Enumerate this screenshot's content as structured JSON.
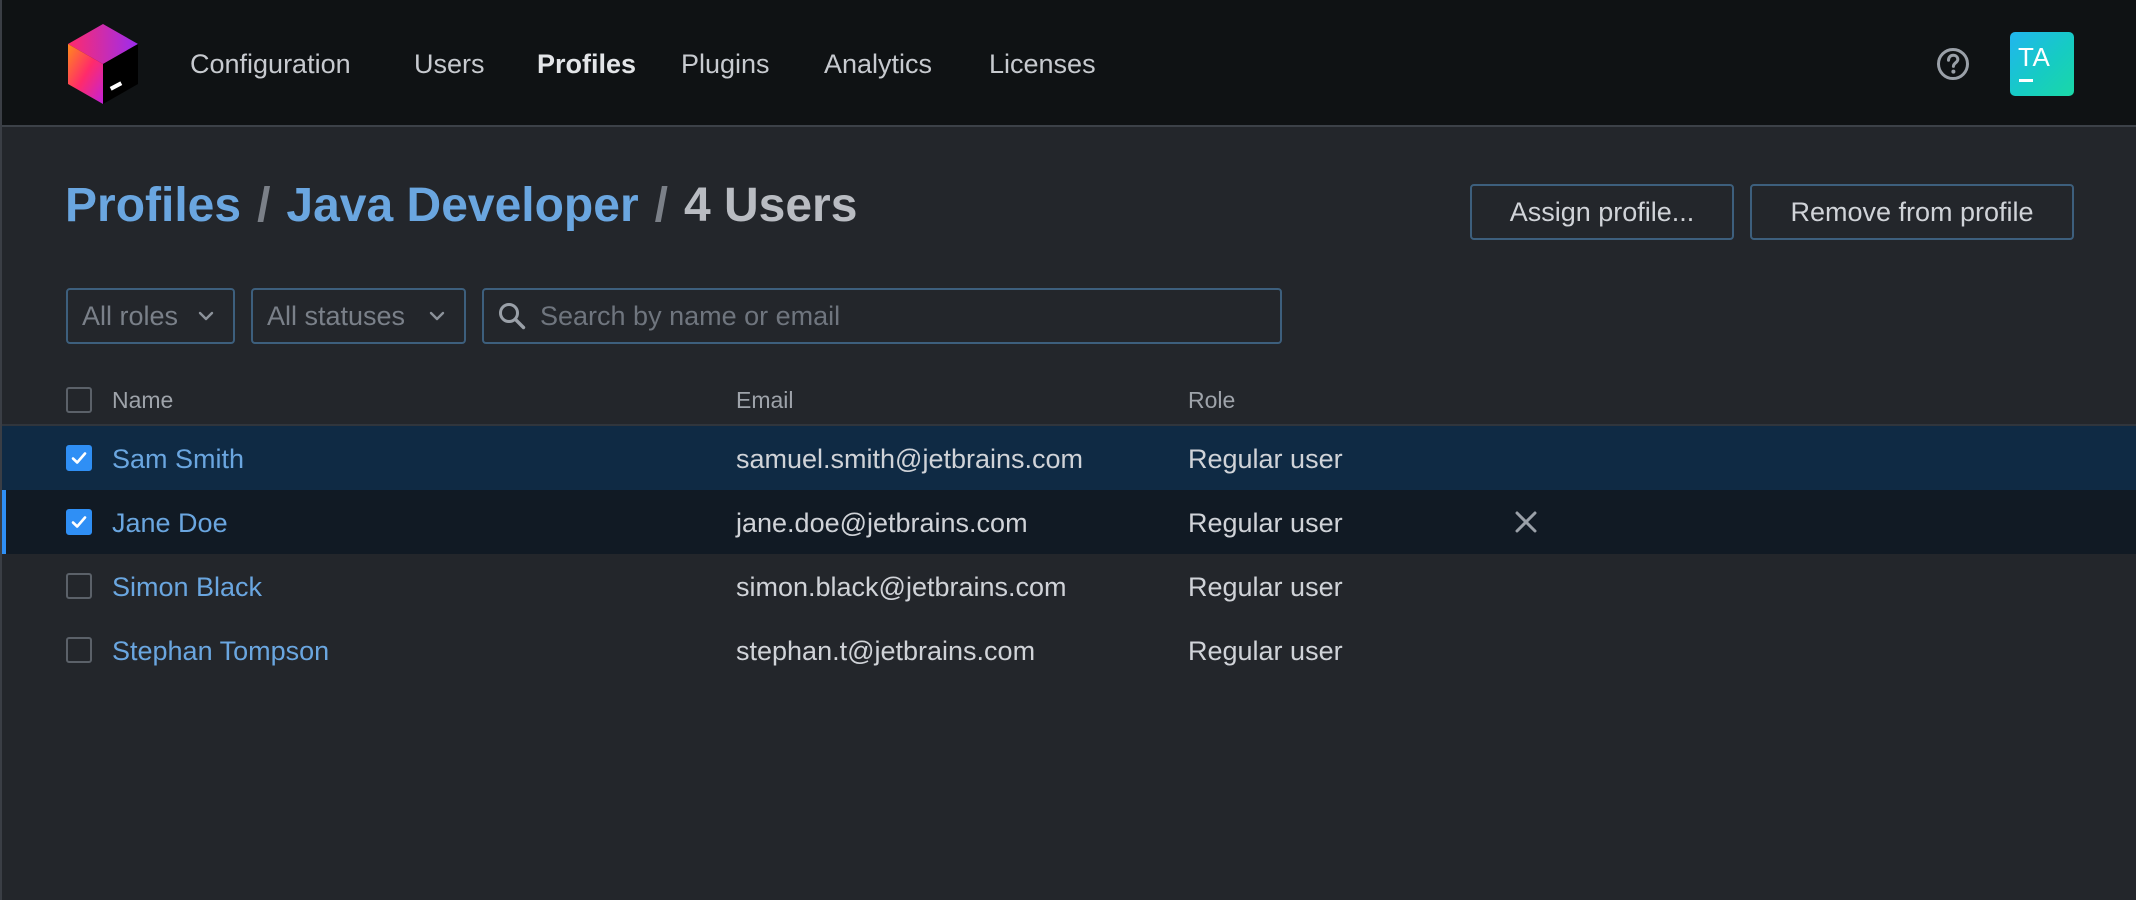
{
  "nav": {
    "items": [
      {
        "label": "Configuration"
      },
      {
        "label": "Users"
      },
      {
        "label": "Profiles",
        "active": true
      },
      {
        "label": "Plugins"
      },
      {
        "label": "Analytics"
      },
      {
        "label": "Licenses"
      }
    ],
    "help_icon": "question-circle-icon",
    "avatar_initials": "TA"
  },
  "breadcrumb": {
    "root": "Profiles",
    "profile": "Java Developer",
    "current": "4 Users",
    "separator": "/"
  },
  "actions": {
    "assign_label": "Assign profile...",
    "remove_label": "Remove from profile"
  },
  "filters": {
    "roles_label": "All roles",
    "statuses_label": "All statuses",
    "search_placeholder": "Search by name or email",
    "search_value": ""
  },
  "table": {
    "columns": {
      "name": "Name",
      "email": "Email",
      "role": "Role"
    },
    "rows": [
      {
        "name": "Sam Smith",
        "email": "samuel.smith@jetbrains.com",
        "role": "Regular user",
        "checked": true,
        "state": "selected"
      },
      {
        "name": "Jane Doe",
        "email": "jane.doe@jetbrains.com",
        "role": "Regular user",
        "checked": true,
        "state": "hover"
      },
      {
        "name": "Simon Black",
        "email": "simon.black@jetbrains.com",
        "role": "Regular user",
        "checked": false,
        "state": "normal"
      },
      {
        "name": "Stephan Tompson",
        "email": "stephan.t@jetbrains.com",
        "role": "Regular user",
        "checked": false,
        "state": "normal"
      }
    ]
  },
  "colors": {
    "accent": "#2f8ff5",
    "link": "#6aa6e0",
    "topbar_bg": "#0f1214",
    "page_bg": "#23262b",
    "selected_row_bg": "#0f2a44"
  }
}
